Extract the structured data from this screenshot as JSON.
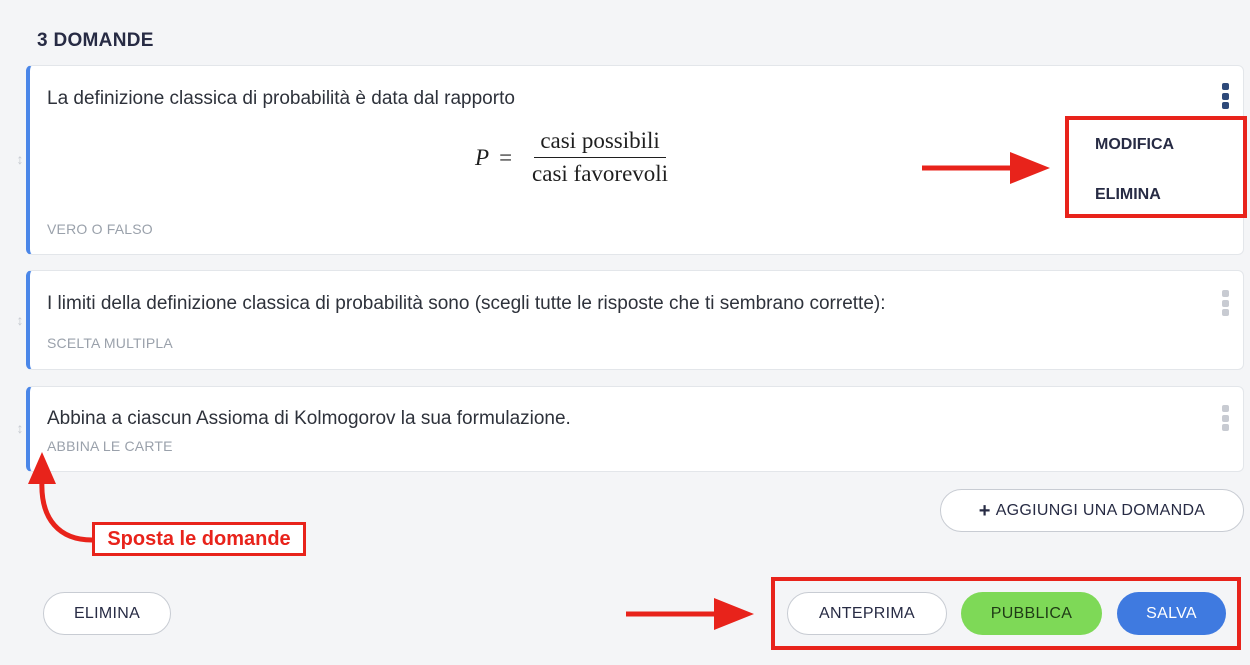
{
  "section": {
    "title": "3 DOMANDE"
  },
  "questions": [
    {
      "text": "La definizione classica di probabilità è data dal rapporto",
      "formula": {
        "lhs": "P",
        "eq": "=",
        "numerator": "casi possibili",
        "denominator": "casi favorevoli"
      },
      "type": "VERO O FALSO"
    },
    {
      "text": "I limiti della definizione classica di probabilità sono (scegli tutte le risposte che ti sembrano corrette):",
      "type": "SCELTA MULTIPLA"
    },
    {
      "text": "Abbina a ciascun Assioma di Kolmogorov la sua formulazione.",
      "type": "ABBINA LE CARTE"
    }
  ],
  "context_menu": {
    "items": [
      "MODIFICA",
      "ELIMINA"
    ]
  },
  "add_question": {
    "icon": "plus-icon",
    "label": "AGGIUNGI UNA DOMANDA"
  },
  "footer": {
    "delete_label": "ELIMINA",
    "preview_label": "ANTEPRIMA",
    "publish_label": "PUBBLICA",
    "save_label": "SALVA"
  },
  "annotations": {
    "move_questions": "Sposta le domande"
  },
  "colors": {
    "accent_blue": "#3f7ae0",
    "publish_green": "#7ed957",
    "annotation_red": "#e8231b",
    "card_border_blue": "#4a86e8"
  }
}
